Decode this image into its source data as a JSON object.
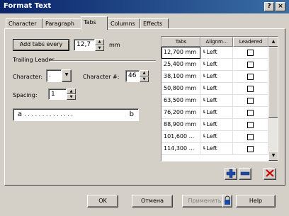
{
  "window": {
    "title": "Format Text",
    "help": "?",
    "close": "×"
  },
  "tabs": [
    "Character",
    "Paragraph",
    "Tabs",
    "Columns",
    "Effects"
  ],
  "tabs_section": {
    "add_tabs_every_label": "Add tabs every",
    "add_tabs_value": "12,7",
    "unit": "mm",
    "trailing_leader": "Trailing Leader",
    "character_label": "Character:",
    "character_value": ".",
    "character_num_label": "Character #:",
    "character_num_value": "46",
    "spacing_label": "Spacing:",
    "spacing_value": "1",
    "preview_left": "a",
    "preview_dots": ". . . . . . . . . . . . . .",
    "preview_right": "b"
  },
  "table": {
    "headers": [
      "Tabs",
      "Alignm...",
      "Leadered"
    ],
    "rows": [
      {
        "pos": "12,700 mm",
        "align": "Left"
      },
      {
        "pos": "25,400 mm",
        "align": "Left"
      },
      {
        "pos": "38,100 mm",
        "align": "Left"
      },
      {
        "pos": "50,800 mm",
        "align": "Left"
      },
      {
        "pos": "63,500 mm",
        "align": "Left"
      },
      {
        "pos": "76,200 mm",
        "align": "Left"
      },
      {
        "pos": "88,900 mm",
        "align": "Left"
      },
      {
        "pos": "101,600 ...",
        "align": "Left"
      },
      {
        "pos": "114,300 ...",
        "align": "Left"
      }
    ]
  },
  "footer": {
    "ok": "OK",
    "cancel": "Отмена",
    "apply": "Применить",
    "help": "Help"
  },
  "colors": {
    "title_start": "#0a246a",
    "title_end": "#3a6ea5",
    "face": "#d4d0c8",
    "delete_red": "#cc0000"
  }
}
